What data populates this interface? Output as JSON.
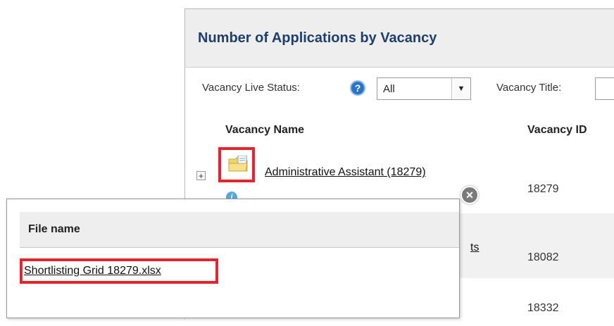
{
  "report": {
    "title": "Number of Applications by Vacancy",
    "filters": {
      "live_status_label": "Vacancy Live Status:",
      "live_status_value": "All",
      "title_label": "Vacancy Title:"
    },
    "columns": {
      "name": "Vacancy Name",
      "id": "Vacancy ID"
    },
    "rows": [
      {
        "name": "Administrative Assistant (18279)",
        "id": "18279"
      },
      {
        "name": "ts",
        "id": "18082"
      },
      {
        "id": "18332"
      }
    ]
  },
  "popup": {
    "column_header": "File name",
    "files": [
      {
        "name": "Shortlisting Grid 18279.xlsx"
      }
    ]
  },
  "colors": {
    "title": "#1e3f6d",
    "highlight": "#e3262d",
    "help_icon": "#2a74c8",
    "info_icon": "#58a8d8"
  },
  "icons": [
    "help-icon",
    "dropdown-arrow-icon",
    "expand-icon",
    "folder-icon",
    "info-icon",
    "close-icon"
  ]
}
